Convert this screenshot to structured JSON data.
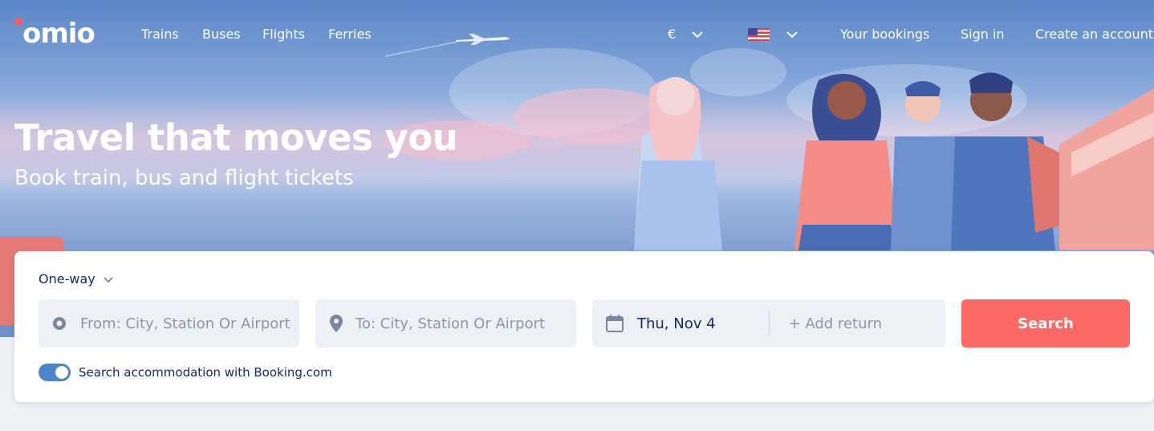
{
  "brand": {
    "logo_text": "omio",
    "accent_color": "#fc5e5e"
  },
  "nav": {
    "links": [
      "Trains",
      "Buses",
      "Flights",
      "Ferries"
    ],
    "currency": "€",
    "locale_flag": "us-flag",
    "account_links": [
      "Your bookings",
      "Sign in",
      "Create an account"
    ]
  },
  "hero": {
    "title": "Travel that moves you",
    "subtitle": "Book train, bus and flight tickets"
  },
  "search": {
    "trip_type": "One-way",
    "from_placeholder": "From: City, Station Or Airport",
    "to_placeholder": "To: City, Station Or Airport",
    "date_value": "Thu, Nov 4",
    "add_return": "+ Add return",
    "search_button": "Search",
    "search_button_color": "#fc6a67",
    "accommodation_label": "Search accommodation with Booking.com",
    "accommodation_enabled": true
  }
}
